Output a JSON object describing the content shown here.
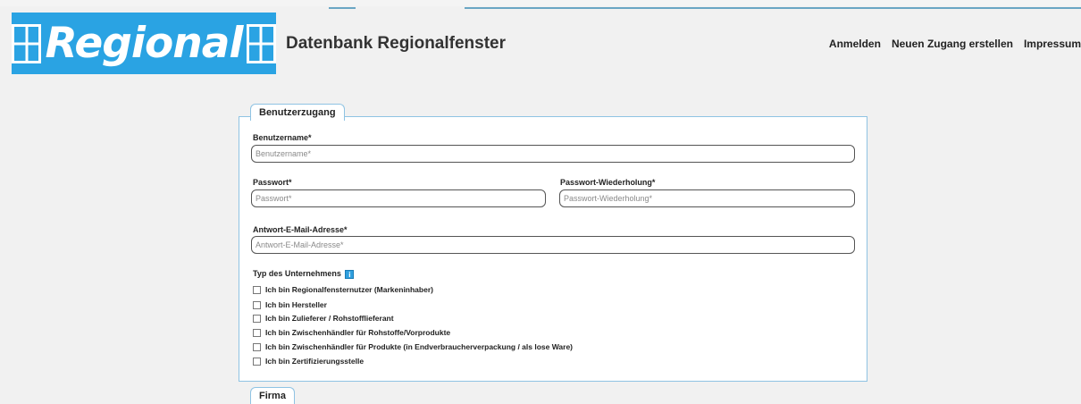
{
  "header": {
    "logo_text": "Regional",
    "site_title": "Datenbank Regionalfenster",
    "nav": [
      {
        "label": "Anmelden"
      },
      {
        "label": "Neuen Zugang erstellen"
      },
      {
        "label": "Impressum"
      }
    ]
  },
  "form": {
    "section_title": "Benutzerzugang",
    "username": {
      "label": "Benutzername*",
      "placeholder": "Benutzername*",
      "value": ""
    },
    "password": {
      "label": "Passwort*",
      "placeholder": "Passwort*",
      "value": ""
    },
    "password_repeat": {
      "label": "Passwort-Wiederholung*",
      "placeholder": "Passwort-Wiederholung*",
      "value": ""
    },
    "email": {
      "label": "Antwort-E-Mail-Adresse*",
      "placeholder": "Antwort-E-Mail-Adresse*",
      "value": ""
    },
    "company_type": {
      "label": "Typ des Unternehmens",
      "info_icon": "i",
      "options": [
        {
          "label": "Ich bin Regionalfensternutzer (Markeninhaber)",
          "checked": false
        },
        {
          "label": "Ich bin Hersteller",
          "checked": false
        },
        {
          "label": "Ich bin Zulieferer / Rohstofflieferant",
          "checked": false
        },
        {
          "label": "Ich bin Zwischenhändler für Rohstoffe/Vorprodukte",
          "checked": false
        },
        {
          "label": "Ich bin Zwischenhändler für Produkte (in Endverbraucherverpackung / als lose Ware)",
          "checked": false
        },
        {
          "label": "Ich bin Zertifizierungsstelle",
          "checked": false
        }
      ]
    },
    "next_section_title": "Firma"
  },
  "colors": {
    "accent": "#2aa3e3",
    "border": "#8fc3e3",
    "background": "#f1f1f1"
  }
}
